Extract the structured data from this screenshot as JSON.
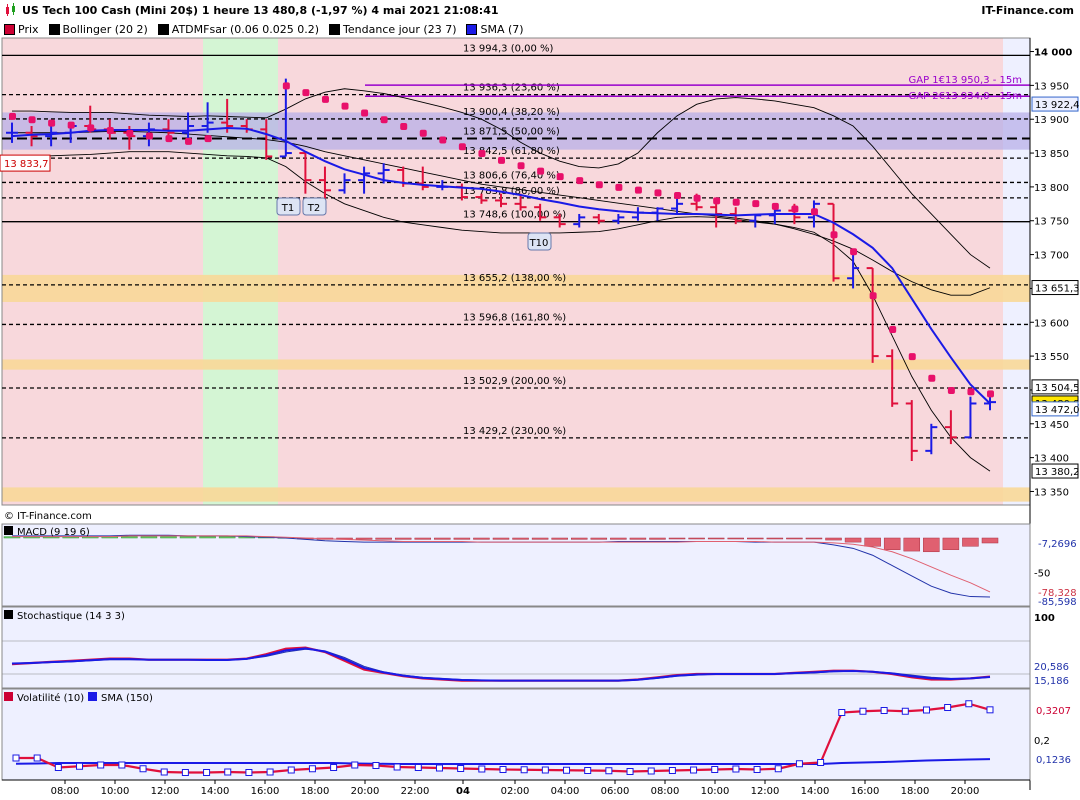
{
  "header": {
    "title": "US Tech 100 Cash (Mini 20$) 1 heure 13 480,8 (-1,97 %) 4 mai 2021 21:08:41",
    "brand": "IT-Finance.com",
    "watermark": "© IT-Finance.com"
  },
  "legend": [
    {
      "label": "Prix",
      "color": "#cc0033"
    },
    {
      "label": "Bollinger (20 2)",
      "color": "#000000"
    },
    {
      "label": "ATDMFsar (0.06 0.025 0.2)",
      "color": "#000000"
    },
    {
      "label": "Tendance jour (23 7)",
      "color": "#000000"
    },
    {
      "label": "SMA (7)",
      "color": "#1a1ae6"
    }
  ],
  "colors": {
    "up": "#1a1ae6",
    "down": "#e0103c",
    "sma": "#1a1ae6",
    "sar": "#e8106a",
    "pinkBg": "#f8d8dc",
    "greenBg": "#d4f5d4",
    "purpleZone": "#b8b0e8",
    "orangeZone": "#f8d898",
    "gap": "#9900cc"
  },
  "chart_data": [
    {
      "type": "candlestick",
      "name": "Prix",
      "x_ticks": [
        "08:00",
        "10:00",
        "12:00",
        "14:00",
        "16:00",
        "18:00",
        "20:00",
        "22:00",
        "04",
        "02:00",
        "04:00",
        "06:00",
        "08:00",
        "10:00",
        "12:00",
        "14:00",
        "16:00",
        "18:00",
        "20:00"
      ],
      "y_ticks": [
        13350,
        13400,
        13450,
        13500,
        13550,
        13600,
        13650,
        13700,
        13750,
        13800,
        13850,
        13900,
        13950,
        14000
      ],
      "y_tick_labels": [
        "13 350",
        "13 400",
        "13 450",
        "13 500",
        "13 550",
        "13 600",
        "13 650",
        "13 700",
        "13 750",
        "13 800",
        "13 850",
        "13 900",
        "13 950",
        "14 000"
      ],
      "ylim": [
        13330,
        14020
      ],
      "ohlc": [
        [
          13880,
          13895,
          13865,
          13880
        ],
        [
          13880,
          13890,
          13860,
          13875
        ],
        [
          13875,
          13890,
          13860,
          13880
        ],
        [
          13880,
          13895,
          13865,
          13890
        ],
        [
          13890,
          13920,
          13880,
          13885
        ],
        [
          13885,
          13900,
          13870,
          13880
        ],
        [
          13880,
          13890,
          13855,
          13875
        ],
        [
          13875,
          13895,
          13860,
          13885
        ],
        [
          13885,
          13900,
          13870,
          13880
        ],
        [
          13880,
          13910,
          13870,
          13890
        ],
        [
          13890,
          13925,
          13880,
          13895
        ],
        [
          13895,
          13930,
          13880,
          13890
        ],
        [
          13890,
          13900,
          13880,
          13885
        ],
        [
          13885,
          13900,
          13840,
          13845
        ],
        [
          13845,
          13960,
          13845,
          13850
        ],
        [
          13850,
          13850,
          13790,
          13810
        ],
        [
          13810,
          13830,
          13780,
          13795
        ],
        [
          13795,
          13820,
          13790,
          13810
        ],
        [
          13810,
          13830,
          13790,
          13820
        ],
        [
          13820,
          13835,
          13805,
          13825
        ],
        [
          13825,
          13830,
          13800,
          13805
        ],
        [
          13805,
          13830,
          13795,
          13800
        ],
        [
          13800,
          13810,
          13795,
          13800
        ],
        [
          13800,
          13805,
          13780,
          13785
        ],
        [
          13785,
          13790,
          13775,
          13780
        ],
        [
          13780,
          13790,
          13770,
          13775
        ],
        [
          13775,
          13790,
          13765,
          13770
        ],
        [
          13770,
          13775,
          13750,
          13755
        ],
        [
          13755,
          13760,
          13740,
          13745
        ],
        [
          13745,
          13760,
          13740,
          13755
        ],
        [
          13755,
          13760,
          13745,
          13750
        ],
        [
          13750,
          13760,
          13745,
          13755
        ],
        [
          13755,
          13770,
          13750,
          13762
        ],
        [
          13762,
          13770,
          13750,
          13768
        ],
        [
          13768,
          13785,
          13760,
          13775
        ],
        [
          13775,
          13790,
          13765,
          13770
        ],
        [
          13770,
          13775,
          13740,
          13760
        ],
        [
          13760,
          13770,
          13745,
          13750
        ],
        [
          13750,
          13760,
          13740,
          13758
        ],
        [
          13758,
          13775,
          13745,
          13765
        ],
        [
          13765,
          13775,
          13745,
          13755
        ],
        [
          13755,
          13780,
          13740,
          13775
        ],
        [
          13775,
          13775,
          13660,
          13665
        ],
        [
          13665,
          13700,
          13650,
          13680
        ],
        [
          13680,
          13680,
          13540,
          13550
        ],
        [
          13550,
          13560,
          13475,
          13480
        ],
        [
          13480,
          13485,
          13395,
          13410
        ],
        [
          13410,
          13450,
          13405,
          13445
        ],
        [
          13445,
          13470,
          13420,
          13430
        ],
        [
          13430,
          13490,
          13430,
          13480
        ],
        [
          13480,
          13495,
          13470,
          13482
        ]
      ],
      "sma7": [
        13875,
        13877,
        13878,
        13880,
        13883,
        13884,
        13884,
        13884,
        13883,
        13883,
        13885,
        13887,
        13886,
        13878,
        13868,
        13852,
        13838,
        13826,
        13818,
        13810,
        13806,
        13803,
        13801,
        13799,
        13797,
        13793,
        13788,
        13782,
        13777,
        13771,
        13767,
        13764,
        13762,
        13761,
        13760,
        13760,
        13759,
        13758,
        13759,
        13760,
        13760,
        13760,
        13747,
        13730,
        13710,
        13680,
        13635,
        13590,
        13548,
        13508,
        13480
      ],
      "sar": [
        13905,
        13900,
        13895,
        13892,
        13888,
        13884,
        13880,
        13876,
        13872,
        13868,
        13872,
        null,
        null,
        null,
        13950,
        13940,
        13930,
        13920,
        13910,
        13900,
        13890,
        13880,
        13870,
        13860,
        13850,
        13840,
        13832,
        13824,
        13816,
        13810,
        13804,
        13800,
        13796,
        13792,
        13788,
        13784,
        13780,
        13778,
        13776,
        13772,
        13768,
        13764,
        13730,
        13705,
        13640,
        13590,
        13550,
        13518,
        13500,
        13498,
        13495
      ],
      "boll_upper": [
        13912,
        13912,
        13911,
        13910,
        13910,
        13910,
        13908,
        13906,
        13905,
        13904,
        13905,
        13904,
        13903,
        13902,
        13915,
        13930,
        13940,
        13945,
        13942,
        13938,
        13932,
        13925,
        13918,
        13910,
        13900,
        13885,
        13866,
        13850,
        13838,
        13830,
        13828,
        13834,
        13850,
        13880,
        13905,
        13922,
        13930,
        13932,
        13930,
        13927,
        13922,
        13917,
        13905,
        13890,
        13860,
        13825,
        13790,
        13760,
        13730,
        13700,
        13680
      ],
      "boll_lower": [
        13845,
        13845,
        13846,
        13847,
        13848,
        13850,
        13852,
        13852,
        13852,
        13850,
        13848,
        13846,
        13845,
        13843,
        13830,
        13808,
        13790,
        13775,
        13765,
        13755,
        13748,
        13744,
        13740,
        13736,
        13734,
        13732,
        13732,
        13732,
        13732,
        13733,
        13734,
        13738,
        13744,
        13750,
        13755,
        13756,
        13755,
        13752,
        13748,
        13745,
        13740,
        13733,
        13715,
        13690,
        13640,
        13580,
        13520,
        13470,
        13430,
        13400,
        13380
      ],
      "boll_mid": [
        13880,
        13880,
        13880,
        13880,
        13881,
        13882,
        13882,
        13881,
        13880,
        13878,
        13876,
        13874,
        13872,
        13870,
        13866,
        13860,
        13852,
        13846,
        13840,
        13834,
        13828,
        13822,
        13816,
        13810,
        13804,
        13800,
        13796,
        13792,
        13788,
        13784,
        13780,
        13776,
        13772,
        13768,
        13764,
        13760,
        13757,
        13754,
        13750,
        13745,
        13738,
        13730,
        13720,
        13708,
        13692,
        13675,
        13660,
        13648,
        13640,
        13640,
        13651
      ],
      "levels": [
        {
          "value": 13994.3,
          "label": "13 994,3 (0,00 %)",
          "style": "solid"
        },
        {
          "value": 13936.3,
          "label": "13 936,3 (23,60 %)",
          "style": "dashed"
        },
        {
          "value": 13900.4,
          "label": "13 900,4 (38,20 %)",
          "style": "dashed"
        },
        {
          "value": 13871.5,
          "label": "13 871,5 (50,00 %)",
          "style": "bold-dashed"
        },
        {
          "value": 13842.5,
          "label": "13 842,5 (61,80 %)",
          "style": "dashed"
        },
        {
          "value": 13806.6,
          "label": "13 806,6 (76,40 %)",
          "style": "dashed"
        },
        {
          "value": 13783.8,
          "label": "13 783,8 (86,00 %)",
          "style": "dashed"
        },
        {
          "value": 13748.6,
          "label": "13 748,6 (100,00 %)",
          "style": "solid"
        },
        {
          "value": 13655.2,
          "label": "13 655,2 (138,00 %)",
          "style": "dashed"
        },
        {
          "value": 13596.8,
          "label": "13 596,8 (161,80 %)",
          "style": "dashed"
        },
        {
          "value": 13502.9,
          "label": "13 502,9 (200,00 %)",
          "style": "dashed"
        },
        {
          "value": 13429.2,
          "label": "13 429,2 (230,00 %)",
          "style": "dashed"
        }
      ],
      "gaps": [
        {
          "value": 13950.3,
          "label": "GAP 1€13 950,3 - 15m"
        },
        {
          "value": 13934.0,
          "label": "GAP 2€13 934,0 - 15m"
        }
      ],
      "markers": [
        "T1",
        "T2",
        "T10"
      ],
      "left_label": "13 833,7",
      "right_labels": [
        {
          "value": 13922.4,
          "text": "13 922,4"
        },
        {
          "value": 13651.3,
          "text": "13 651,3"
        },
        {
          "value": 13504.5,
          "text": "13 504,5"
        },
        {
          "value": 13480.8,
          "text": "13 480,8"
        },
        {
          "value": 13472.0,
          "text": "13 472,0"
        },
        {
          "value": 13380.2,
          "text": "13 380,2"
        }
      ]
    },
    {
      "type": "bar+line",
      "name": "MACD (9 19 6)",
      "histogram": [
        2,
        2,
        2,
        2,
        2,
        2,
        2,
        2,
        2,
        2,
        2,
        2,
        2,
        2,
        1,
        -1,
        -2,
        -2,
        -2,
        -2,
        -2,
        -2,
        -2,
        -2,
        -2,
        -2,
        -2,
        -2,
        -2,
        -2,
        -2,
        -2,
        -2,
        -2,
        -1,
        -1,
        -1,
        -1,
        -1,
        -1,
        -1,
        -1,
        -3,
        -6,
        -12,
        -17,
        -19,
        -20,
        -17,
        -12,
        -7.27
      ],
      "macd": [
        3,
        3,
        3,
        3,
        3,
        3,
        4,
        4,
        4,
        3,
        3,
        3,
        2,
        1,
        0,
        -2,
        -4,
        -5,
        -6,
        -6,
        -6,
        -6,
        -6,
        -6,
        -6,
        -6,
        -6,
        -6,
        -6,
        -6,
        -6,
        -5,
        -5,
        -5,
        -5,
        -5,
        -5,
        -5,
        -6,
        -6,
        -6,
        -6,
        -10,
        -15,
        -25,
        -40,
        -55,
        -70,
        -80,
        -85,
        -85.6
      ],
      "signal": [
        2,
        2,
        2,
        2,
        2,
        2,
        3,
        3,
        3,
        3,
        3,
        3,
        3,
        2,
        1,
        0,
        -1,
        -2,
        -3,
        -4,
        -5,
        -5,
        -5,
        -5,
        -6,
        -6,
        -6,
        -6,
        -6,
        -6,
        -6,
        -6,
        -6,
        -6,
        -6,
        -5,
        -5,
        -5,
        -5,
        -6,
        -6,
        -6,
        -7,
        -9,
        -13,
        -20,
        -30,
        -42,
        -54,
        -65,
        -78.3
      ],
      "value_labels": [
        "-7,2696",
        "-78,328",
        "-85,598"
      ],
      "y_ticks": [
        "-50"
      ]
    },
    {
      "type": "line",
      "name": "Stochastique (14 3 3)",
      "k": [
        38,
        40,
        42,
        44,
        46,
        48,
        48,
        46,
        46,
        46,
        46,
        46,
        48,
        56,
        66,
        68,
        60,
        44,
        28,
        22,
        16,
        12,
        10,
        8,
        8,
        8,
        8,
        8,
        8,
        8,
        8,
        8,
        10,
        14,
        18,
        20,
        20,
        20,
        20,
        20,
        22,
        24,
        26,
        26,
        24,
        20,
        14,
        10,
        10,
        12,
        15.2
      ],
      "d": [
        40,
        40,
        41,
        42,
        44,
        46,
        46,
        46,
        46,
        46,
        45,
        45,
        47,
        52,
        60,
        65,
        62,
        50,
        34,
        24,
        18,
        14,
        12,
        10,
        9,
        8,
        8,
        8,
        8,
        8,
        8,
        8,
        9,
        12,
        16,
        18,
        20,
        20,
        20,
        20,
        21,
        22,
        24,
        25,
        24,
        22,
        18,
        14,
        12,
        12,
        14
      ],
      "value_labels": [
        "20,586",
        "15,186"
      ],
      "y_ticks": [
        "100"
      ]
    },
    {
      "type": "line",
      "name": "Volatilité (10) / SMA (150)",
      "volatility": [
        0.128,
        0.128,
        0.09,
        0.095,
        0.1,
        0.1,
        0.085,
        0.072,
        0.07,
        0.07,
        0.072,
        0.07,
        0.072,
        0.08,
        0.085,
        0.09,
        0.1,
        0.098,
        0.092,
        0.09,
        0.088,
        0.086,
        0.084,
        0.082,
        0.081,
        0.08,
        0.079,
        0.078,
        0.077,
        0.074,
        0.076,
        0.078,
        0.08,
        0.082,
        0.084,
        0.082,
        0.085,
        0.105,
        0.11,
        0.31,
        0.315,
        0.318,
        0.315,
        0.32,
        0.33,
        0.345,
        0.3207
      ],
      "sma150": [
        0.105,
        0.106,
        0.108,
        0.108,
        0.108,
        0.108,
        0.108,
        0.108,
        0.108,
        0.108,
        0.108,
        0.108,
        0.108,
        0.108,
        0.108,
        0.108,
        0.106,
        0.105,
        0.104,
        0.104,
        0.104,
        0.104,
        0.104,
        0.104,
        0.104,
        0.104,
        0.104,
        0.104,
        0.104,
        0.104,
        0.104,
        0.104,
        0.104,
        0.104,
        0.104,
        0.104,
        0.104,
        0.104,
        0.104,
        0.108,
        0.11,
        0.112,
        0.115,
        0.118,
        0.12,
        0.122,
        0.1236
      ],
      "value_labels": [
        "0,3207",
        "0,1236"
      ],
      "y_ticks": [
        "0,2"
      ]
    }
  ]
}
